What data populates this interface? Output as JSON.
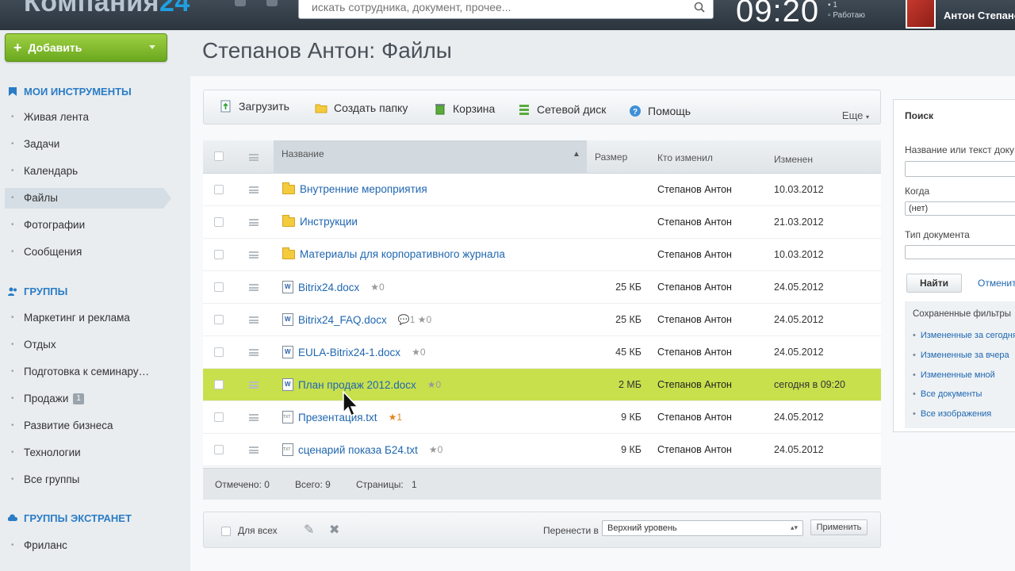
{
  "topbar": {
    "logo_text": "Компания",
    "logo_num": "24",
    "search_placeholder": "искать сотрудника, документ, прочее...",
    "clock": "09:20",
    "work_count": "1",
    "work_status": "Работаю",
    "user_name": "Антон Степанов"
  },
  "sidebar": {
    "add_label": "Добавить",
    "sections": {
      "tools": "МОИ ИНСТРУМЕНТЫ",
      "groups": "ГРУППЫ",
      "extranet": "ГРУППЫ ЭКСТРАНЕТ"
    },
    "tools": [
      "Живая лента",
      "Задачи",
      "Календарь",
      "Файлы",
      "Фотографии",
      "Сообщения"
    ],
    "groups": [
      "Маркетинг и реклама",
      "Отдых",
      "Подготовка к семинару…",
      "Продажи",
      "Развитие бизнеса",
      "Технологии",
      "Все группы"
    ],
    "sales_badge": "1",
    "extranet": [
      "Фриланс"
    ]
  },
  "page_title": "Степанов Антон: Файлы",
  "toolbar": {
    "upload": "Загрузить",
    "create_folder": "Создать папку",
    "trash": "Корзина",
    "network_disk": "Сетевой диск",
    "help": "Помощь",
    "more": "Еще"
  },
  "table": {
    "headers": {
      "name": "Название",
      "size": "Размер",
      "modified_by": "Кто изменил",
      "modified": "Изменен"
    },
    "rows": [
      {
        "type": "folder",
        "name": "Внутренние мероприятия",
        "size": "",
        "by": "Степанов Антон",
        "date": "10.03.2012",
        "meta": ""
      },
      {
        "type": "folder",
        "name": "Инструкции",
        "size": "",
        "by": "Степанов Антон",
        "date": "21.03.2012",
        "meta": ""
      },
      {
        "type": "folder",
        "name": "Материалы для корпоративного журнала",
        "size": "",
        "by": "Степанов Антон",
        "date": "10.03.2012",
        "meta": ""
      },
      {
        "type": "word",
        "name": "Bitrix24.docx",
        "size": "25 КБ",
        "by": "Степанов Антон",
        "date": "24.05.2012",
        "meta": "★0"
      },
      {
        "type": "word",
        "name": "Bitrix24_FAQ.docx",
        "size": "25 КБ",
        "by": "Степанов Антон",
        "date": "24.05.2012",
        "meta": "💬1   ★0"
      },
      {
        "type": "word",
        "name": "EULA-Bitrix24-1.docx",
        "size": "45 КБ",
        "by": "Степанов Антон",
        "date": "24.05.2012",
        "meta": "★0"
      },
      {
        "type": "word",
        "name": "План продаж 2012.docx",
        "size": "2 МБ",
        "by": "Степанов Антон",
        "date": "сегодня в 09:20",
        "meta": "★0"
      },
      {
        "type": "txt",
        "name": "Презентация.txt",
        "size": "9 КБ",
        "by": "Степанов Антон",
        "date": "24.05.2012",
        "meta": "★1"
      },
      {
        "type": "txt",
        "name": "сценарий показа Б24.txt",
        "size": "9 КБ",
        "by": "Степанов Антон",
        "date": "24.05.2012",
        "meta": "★0"
      }
    ],
    "highlighted_row": 6,
    "footer": {
      "selected": "Отмечено: 0",
      "total": "Всего: 9",
      "pages": "Страницы:",
      "page_num": "1"
    }
  },
  "action_bar": {
    "for_all": "Для всех",
    "move_to": "Перенести в",
    "target": "Верхний уровень",
    "apply": "Применить"
  },
  "filter": {
    "title": "Поиск",
    "name_label": "Название или текст доку",
    "when_label": "Когда",
    "when_value": "(нет)",
    "type_label": "Тип документа",
    "find": "Найти",
    "cancel": "Отменить",
    "saved_title": "Сохраненные фильтры",
    "saved": [
      "Измененные за сегодня",
      "Измененные за вчера",
      "Измененные мной",
      "Все документы",
      "Все изображения"
    ]
  },
  "colors": {
    "accent_blue": "#2067b0",
    "highlight_row": "#c9e04d",
    "add_button": "#7fbb2a"
  }
}
